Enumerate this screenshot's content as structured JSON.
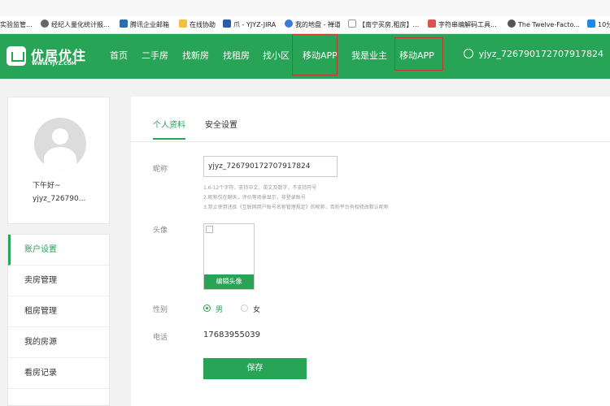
{
  "bookmarks": [
    {
      "label": "实验监管...",
      "color": "#4a90d9"
    },
    {
      "label": "经纪人量化统计报...",
      "color": "#666666"
    },
    {
      "label": "腾讯企业邮箱",
      "color": "#2b6cb0"
    },
    {
      "label": "在线协助",
      "color": "#f0c040"
    },
    {
      "label": "爪 - YJYZ-JIRA",
      "color": "#2a5caa"
    },
    {
      "label": "我的地盘 - 禅道",
      "color": "#3a7bd5"
    },
    {
      "label": "【南宁买房,租房】...",
      "color": "#999999"
    },
    {
      "label": "字符串编解码工具...",
      "color": "#d9534f"
    },
    {
      "label": "The Twelve-Facto...",
      "color": "#555555"
    },
    {
      "label": "10分",
      "color": "#1e88e5"
    }
  ],
  "header": {
    "logo_text": "优居优住",
    "logo_sub": "WWW.YJYZ.COM",
    "nav": [
      "首页",
      "二手房",
      "找新房",
      "找租房",
      "找小区",
      "移动APP",
      "我是业主",
      "移动APP"
    ],
    "username": "yjyz_726790172707917824",
    "bg_color": "#27a456"
  },
  "profile": {
    "greeting": "下午好~",
    "username_short": "yjyz_726790..."
  },
  "menu": {
    "items": [
      "账户设置",
      "卖房管理",
      "租房管理",
      "我的房源",
      "看房记录"
    ],
    "active_index": 0
  },
  "tabs": {
    "items": [
      "个人资料",
      "安全设置"
    ],
    "active_index": 0
  },
  "form": {
    "nickname_label": "昵称",
    "nickname_value": "yjyz_726790172707917824",
    "hints": [
      "1.6-12个字符，支持中文，英文及数字，不支持符号",
      "2.昵称仅在聊天，评价等场景显示，非登录账号",
      "3.禁止使用违反《互联网用户账号名称管理规定》的昵称，否则平台有权修改默认昵称"
    ],
    "avatar_label": "头像",
    "edit_avatar": "编辑头像",
    "gender_label": "性别",
    "gender_options": [
      "男",
      "女"
    ],
    "gender_selected": 0,
    "phone_label": "电话",
    "phone_value": "17683955039",
    "save_label": "保存"
  }
}
